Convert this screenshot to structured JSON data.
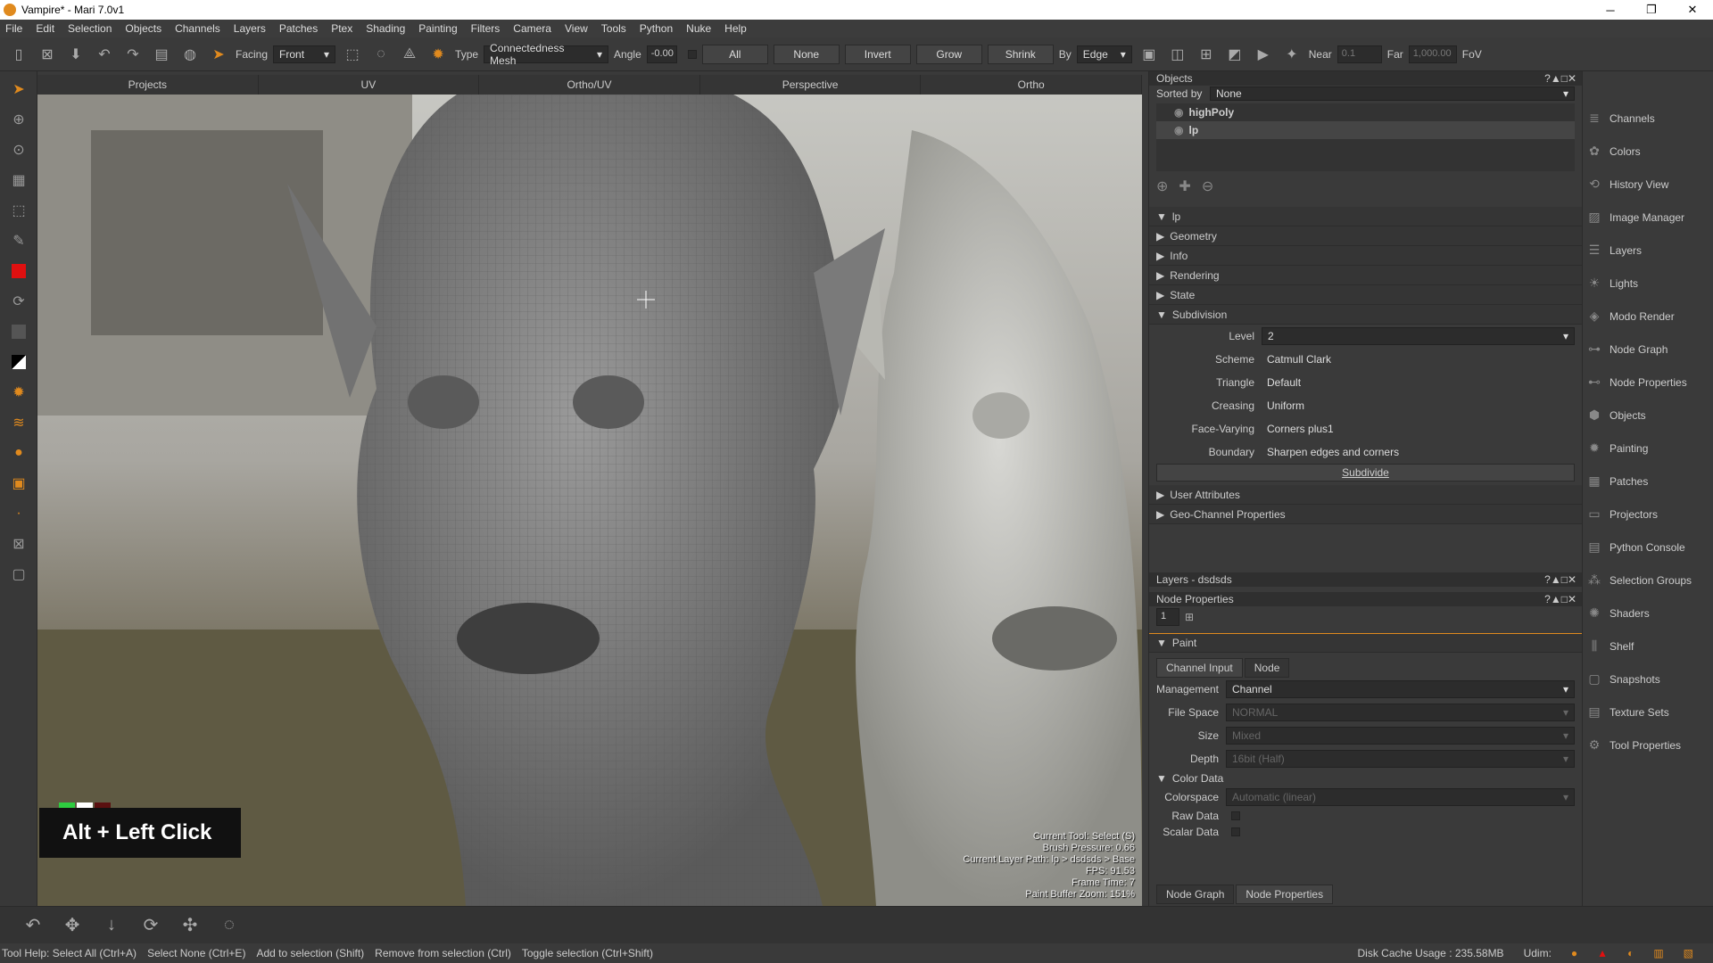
{
  "window": {
    "title": "Vampire* - Mari 7.0v1",
    "min": "─",
    "max": "❐",
    "close": "✕"
  },
  "menu": [
    "File",
    "Edit",
    "Selection",
    "Objects",
    "Channels",
    "Layers",
    "Patches",
    "Ptex",
    "Shading",
    "Painting",
    "Filters",
    "Camera",
    "View",
    "Tools",
    "Python",
    "Nuke",
    "Help"
  ],
  "toolbar": {
    "facing_label": "Facing",
    "facing_value": "Front",
    "type_label": "Type",
    "type_value": "Connectedness Mesh",
    "angle_label": "Angle",
    "angle_value": "-0.00",
    "buttons": [
      "All",
      "None",
      "Invert",
      "Grow",
      "Shrink"
    ],
    "by_label": "By",
    "by_value": "Edge",
    "near_label": "Near",
    "near_value": "0.1",
    "far_label": "Far",
    "far_value": "1,000.00",
    "fov_label": "FoV"
  },
  "view_tabs": [
    "Projects",
    "UV",
    "Ortho/UV",
    "Perspective",
    "Ortho"
  ],
  "viewport": {
    "hotkey": "Alt + Left Click",
    "overlay": [
      "Current Tool: Select (S)",
      "Brush Pressure: 0.66",
      "Current Layer Path: lp > dsdsds > Base",
      "FPS: 91.53",
      "Frame Time: 7",
      "Paint Buffer Zoom: 151%"
    ]
  },
  "objects_panel": {
    "title": "Objects",
    "sorted_by_label": "Sorted by",
    "sorted_by_value": "None",
    "items": [
      "highPoly",
      "lp"
    ]
  },
  "lp_panel": {
    "title": "lp",
    "sections": [
      "Geometry",
      "Info",
      "Rendering",
      "State"
    ],
    "subdivision": {
      "title": "Subdivision",
      "level_label": "Level",
      "level_value": "2",
      "scheme_label": "Scheme",
      "scheme_value": "Catmull Clark",
      "triangle_label": "Triangle",
      "triangle_value": "Default",
      "creasing_label": "Creasing",
      "creasing_value": "Uniform",
      "facevarying_label": "Face-Varying",
      "facevarying_value": "Corners plus1",
      "boundary_label": "Boundary",
      "boundary_value": "Sharpen edges and corners",
      "subdivide_button": "Subdivide"
    },
    "user_attributes": "User Attributes",
    "geo_channel": "Geo-Channel Properties"
  },
  "layers_panel": {
    "title": "Layers - dsdsds"
  },
  "node_props": {
    "title": "Node Properties",
    "field_value": "1",
    "paint_title": "Paint",
    "tabs": [
      "Channel Input",
      "Node"
    ],
    "management_label": "Management",
    "management_value": "Channel",
    "filespace_label": "File Space",
    "filespace_value": "NORMAL",
    "size_label": "Size",
    "size_value": "Mixed",
    "depth_label": "Depth",
    "depth_value": "16bit (Half)",
    "colordata_title": "Color Data",
    "colorspace_label": "Colorspace",
    "colorspace_value": "Automatic (linear)",
    "rawdata_label": "Raw Data",
    "scalardata_label": "Scalar Data"
  },
  "bottom_tabs": [
    "Node Graph",
    "Node Properties"
  ],
  "palettes": [
    "Channels",
    "Colors",
    "History View",
    "Image Manager",
    "Layers",
    "Lights",
    "Modo Render",
    "Node Graph",
    "Node Properties",
    "Objects",
    "Painting",
    "Patches",
    "Projectors",
    "Python Console",
    "Selection Groups",
    "Shaders",
    "Shelf",
    "Snapshots",
    "Texture Sets",
    "Tool Properties"
  ],
  "status": {
    "tool_help": "Tool Help: Select All (Ctrl+A)",
    "hints": [
      "Select None (Ctrl+E)",
      "Add to selection (Shift)",
      "Remove from selection (Ctrl)",
      "Toggle selection (Ctrl+Shift)"
    ],
    "disk_cache": "Disk Cache Usage : 235.58MB",
    "udim": "Udim:"
  }
}
